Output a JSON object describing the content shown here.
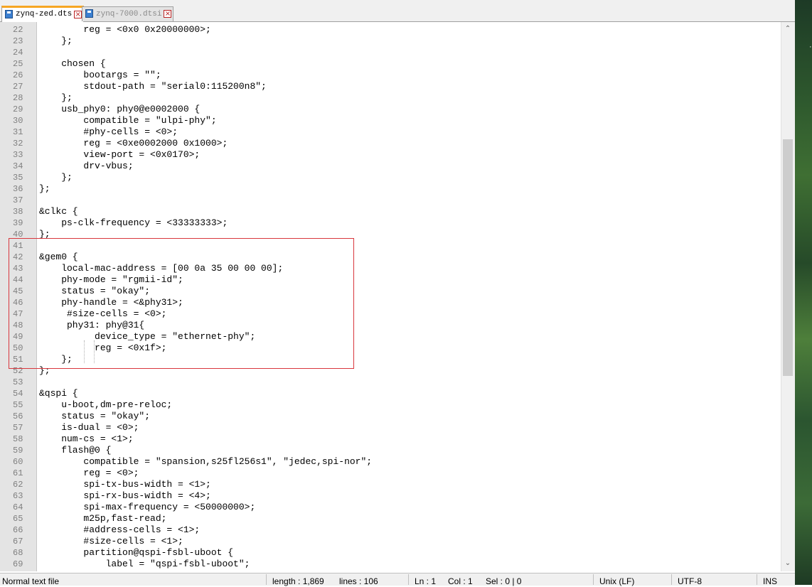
{
  "tabs": [
    {
      "label": "zynq-zed.dts",
      "active": true
    },
    {
      "label": "zynq-7000.dtsi",
      "active": false
    }
  ],
  "lines": [
    {
      "n": "22",
      "t": "        reg = <0x0 0x20000000>;"
    },
    {
      "n": "23",
      "t": "    };"
    },
    {
      "n": "24",
      "t": ""
    },
    {
      "n": "25",
      "t": "    chosen {"
    },
    {
      "n": "26",
      "t": "        bootargs = \"\";"
    },
    {
      "n": "27",
      "t": "        stdout-path = \"serial0:115200n8\";"
    },
    {
      "n": "28",
      "t": "    };"
    },
    {
      "n": "29",
      "t": "    usb_phy0: phy0@e0002000 {"
    },
    {
      "n": "30",
      "t": "        compatible = \"ulpi-phy\";"
    },
    {
      "n": "31",
      "t": "        #phy-cells = <0>;"
    },
    {
      "n": "32",
      "t": "        reg = <0xe0002000 0x1000>;"
    },
    {
      "n": "33",
      "t": "        view-port = <0x0170>;"
    },
    {
      "n": "34",
      "t": "        drv-vbus;"
    },
    {
      "n": "35",
      "t": "    };"
    },
    {
      "n": "36",
      "t": "};"
    },
    {
      "n": "37",
      "t": ""
    },
    {
      "n": "38",
      "t": "&clkc {"
    },
    {
      "n": "39",
      "t": "    ps-clk-frequency = <33333333>;"
    },
    {
      "n": "40",
      "t": "};"
    },
    {
      "n": "41",
      "t": ""
    },
    {
      "n": "42",
      "t": "&gem0 {"
    },
    {
      "n": "43",
      "t": "    local-mac-address = [00 0a 35 00 00 00];"
    },
    {
      "n": "44",
      "t": "    phy-mode = \"rgmii-id\";"
    },
    {
      "n": "45",
      "t": "    status = \"okay\";"
    },
    {
      "n": "46",
      "t": "    phy-handle = <&phy31>;"
    },
    {
      "n": "47",
      "t": "     #size-cells = <0>;"
    },
    {
      "n": "48",
      "t": "     phy31: phy@31{"
    },
    {
      "n": "49",
      "t": "          device_type = \"ethernet-phy\";"
    },
    {
      "n": "50",
      "t": "          reg = <0x1f>;"
    },
    {
      "n": "51",
      "t": "    };"
    },
    {
      "n": "52",
      "t": "};"
    },
    {
      "n": "53",
      "t": ""
    },
    {
      "n": "54",
      "t": "&qspi {"
    },
    {
      "n": "55",
      "t": "    u-boot,dm-pre-reloc;"
    },
    {
      "n": "56",
      "t": "    status = \"okay\";"
    },
    {
      "n": "57",
      "t": "    is-dual = <0>;"
    },
    {
      "n": "58",
      "t": "    num-cs = <1>;"
    },
    {
      "n": "59",
      "t": "    flash@0 {"
    },
    {
      "n": "60",
      "t": "        compatible = \"spansion,s25fl256s1\", \"jedec,spi-nor\";"
    },
    {
      "n": "61",
      "t": "        reg = <0>;"
    },
    {
      "n": "62",
      "t": "        spi-tx-bus-width = <1>;"
    },
    {
      "n": "63",
      "t": "        spi-rx-bus-width = <4>;"
    },
    {
      "n": "64",
      "t": "        spi-max-frequency = <50000000>;"
    },
    {
      "n": "65",
      "t": "        m25p,fast-read;"
    },
    {
      "n": "66",
      "t": "        #address-cells = <1>;"
    },
    {
      "n": "67",
      "t": "        #size-cells = <1>;"
    },
    {
      "n": "68",
      "t": "        partition@qspi-fsbl-uboot {"
    },
    {
      "n": "69",
      "t": "            label = \"qspi-fsbl-uboot\";"
    }
  ],
  "status": {
    "file_type": "Normal text file",
    "length": "length : 1,869",
    "lines": "lines : 106",
    "ln": "Ln : 1",
    "col": "Col : 1",
    "sel": "Sel : 0 | 0",
    "eol": "Unix (LF)",
    "encoding": "UTF-8",
    "mode": "INS"
  },
  "colors": {
    "active_tab_accent": "#f6a623",
    "highlight_box": "#d9373d",
    "gutter": "#e4e4e4"
  }
}
